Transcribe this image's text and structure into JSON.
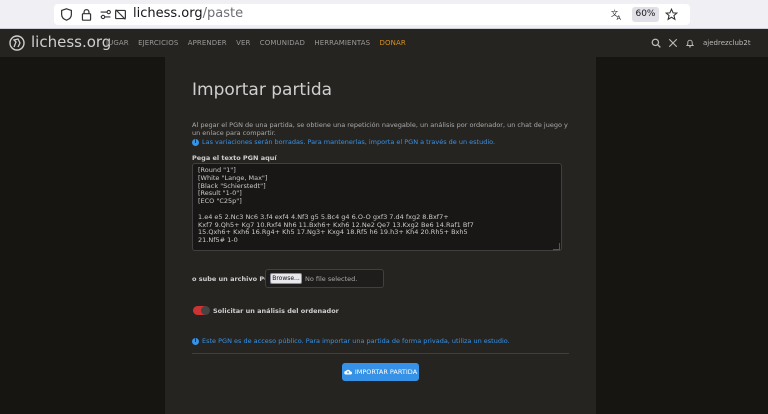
{
  "browser": {
    "url_domain": "lichess.org",
    "url_path": "/paste",
    "zoom": "60%"
  },
  "header": {
    "logo_text": "lichess.org",
    "nav": [
      "JUGAR",
      "EJERCICIOS",
      "APRENDER",
      "VER",
      "COMUNIDAD",
      "HERRAMIENTAS",
      "DONAR"
    ],
    "username": "ajedrezclub2t"
  },
  "form": {
    "title": "Importar partida",
    "description": "Al pegar el PGN de una partida, se obtiene una repetición navegable, un análisis por ordenador, un chat de juego y un enlace para compartir.",
    "variations_note": "Las variaciones serán borradas. Para mantenerlas, importa el PGN a través de un estudio.",
    "pgn_label": "Pega el texto PGN aquí",
    "pgn_text": "[Round \"1\"]\n[White \"Lange, Max\"]\n[Black \"Schierstedt\"]\n[Result \"1-0\"]\n[ECO \"C25p\"]\n\n1.e4 e5 2.Nc3 Nc6 3.f4 exf4 4.Nf3 g5 5.Bc4 g4 6.O-O gxf3 7.d4 fxg2 8.Bxf7+\nKxf7 9.Qh5+ Kg7 10.Rxf4 Nh6 11.Bxh6+ Kxh6 12.Ne2 Qe7 13.Kxg2 Be6 14.Raf1 Bf7\n15.Qxh6+ Kxh6 16.Rg4+ Kh5 17.Ng3+ Kxg4 18.Rf5 h6 19.h3+ Kh4 20.Rh5+ Bxh5\n21.Nf5# 1-0",
    "upload_label": "o sube un archivo PGN",
    "browse_label": "Browse...",
    "no_file_label": "No file selected.",
    "analysis_label": "Solicitar un análisis del ordenador",
    "public_note": "Este PGN es de acceso público. Para importar una partida de forma privada, utiliza un estudio.",
    "submit_label": "IMPORTAR PARTIDA"
  },
  "colors": {
    "accent": "#3692e7",
    "donate": "#d59120",
    "toggle_off": "#cc3333"
  }
}
